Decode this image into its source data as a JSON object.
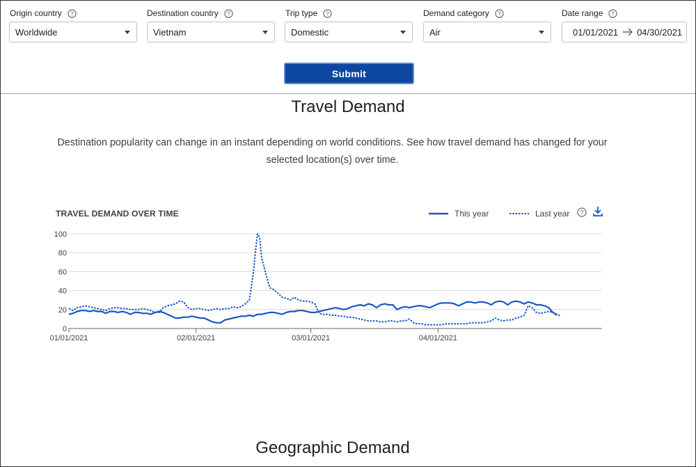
{
  "filters": {
    "origin": {
      "label": "Origin country",
      "value": "Worldwide"
    },
    "destination": {
      "label": "Destination country",
      "value": "Vietnam"
    },
    "trip_type": {
      "label": "Trip type",
      "value": "Domestic"
    },
    "demand_category": {
      "label": "Demand category",
      "value": "Air"
    },
    "date_range": {
      "label": "Date range",
      "start": "01/01/2021",
      "end": "04/30/2021"
    }
  },
  "submit_label": "Submit",
  "page_title": "Travel Demand",
  "description": "Destination popularity can change in an instant depending on world conditions. See how travel demand has changed for your selected location(s) over time.",
  "chart_title": "TRAVEL DEMAND OVER TIME",
  "legend": {
    "this_year": "This year",
    "last_year": "Last year"
  },
  "section_title": "Geographic Demand",
  "colors": {
    "accent": "#1a56c4",
    "submit": "#0d47a1"
  },
  "chart_data": {
    "type": "line",
    "title": "TRAVEL DEMAND OVER TIME",
    "x_ticks": [
      "01/01/2021",
      "02/01/2021",
      "03/01/2021",
      "04/01/2021"
    ],
    "x_tick_days": [
      0,
      31,
      59,
      90
    ],
    "y_ticks": [
      0,
      20,
      40,
      60,
      80,
      100
    ],
    "ylim": [
      0,
      100
    ],
    "x_range_days": [
      0,
      130
    ],
    "grid": true,
    "legend_position": "top-right",
    "series": [
      {
        "name": "This year",
        "style": "solid",
        "points": [
          [
            0,
            15
          ],
          [
            1,
            16
          ],
          [
            2,
            18
          ],
          [
            3,
            19
          ],
          [
            4,
            19
          ],
          [
            5,
            18
          ],
          [
            6,
            19
          ],
          [
            7,
            18
          ],
          [
            8,
            18
          ],
          [
            9,
            16
          ],
          [
            10,
            18
          ],
          [
            11,
            18
          ],
          [
            12,
            17
          ],
          [
            13,
            18
          ],
          [
            14,
            17
          ],
          [
            15,
            15
          ],
          [
            16,
            17
          ],
          [
            17,
            17
          ],
          [
            18,
            16
          ],
          [
            19,
            16
          ],
          [
            20,
            15
          ],
          [
            21,
            17
          ],
          [
            22,
            18
          ],
          [
            23,
            17
          ],
          [
            24,
            15
          ],
          [
            25,
            13
          ],
          [
            26,
            11
          ],
          [
            27,
            11
          ],
          [
            28,
            12
          ],
          [
            29,
            12
          ],
          [
            30,
            13
          ],
          [
            31,
            12
          ],
          [
            32,
            11
          ],
          [
            33,
            11
          ],
          [
            34,
            9
          ],
          [
            35,
            7
          ],
          [
            36,
            6
          ],
          [
            37,
            6
          ],
          [
            38,
            9
          ],
          [
            39,
            10
          ],
          [
            40,
            11
          ],
          [
            41,
            12
          ],
          [
            42,
            13
          ],
          [
            43,
            13
          ],
          [
            44,
            14
          ],
          [
            45,
            13
          ],
          [
            46,
            15
          ],
          [
            47,
            15
          ],
          [
            48,
            16
          ],
          [
            49,
            17
          ],
          [
            50,
            17
          ],
          [
            51,
            16
          ],
          [
            52,
            15
          ],
          [
            53,
            17
          ],
          [
            54,
            18
          ],
          [
            55,
            18
          ],
          [
            56,
            19
          ],
          [
            57,
            19
          ],
          [
            58,
            18
          ],
          [
            59,
            17
          ],
          [
            60,
            17
          ],
          [
            61,
            18
          ],
          [
            62,
            19
          ],
          [
            63,
            20
          ],
          [
            64,
            21
          ],
          [
            65,
            22
          ],
          [
            66,
            21
          ],
          [
            67,
            20
          ],
          [
            68,
            21
          ],
          [
            69,
            23
          ],
          [
            70,
            24
          ],
          [
            71,
            25
          ],
          [
            72,
            24
          ],
          [
            73,
            26
          ],
          [
            74,
            25
          ],
          [
            75,
            22
          ],
          [
            76,
            25
          ],
          [
            77,
            26
          ],
          [
            78,
            25
          ],
          [
            79,
            25
          ],
          [
            80,
            20
          ],
          [
            81,
            22
          ],
          [
            82,
            23
          ],
          [
            83,
            22
          ],
          [
            84,
            23
          ],
          [
            85,
            24
          ],
          [
            86,
            24
          ],
          [
            87,
            23
          ],
          [
            88,
            22
          ],
          [
            89,
            24
          ],
          [
            90,
            26
          ],
          [
            91,
            27
          ],
          [
            92,
            27
          ],
          [
            93,
            27
          ],
          [
            94,
            26
          ],
          [
            95,
            24
          ],
          [
            96,
            26
          ],
          [
            97,
            28
          ],
          [
            98,
            28
          ],
          [
            99,
            27
          ],
          [
            100,
            28
          ],
          [
            101,
            28
          ],
          [
            102,
            27
          ],
          [
            103,
            25
          ],
          [
            104,
            28
          ],
          [
            105,
            29
          ],
          [
            106,
            28
          ],
          [
            107,
            25
          ],
          [
            108,
            28
          ],
          [
            109,
            29
          ],
          [
            110,
            28
          ],
          [
            111,
            26
          ],
          [
            112,
            28
          ],
          [
            113,
            27
          ],
          [
            114,
            25
          ],
          [
            115,
            25
          ],
          [
            116,
            24
          ],
          [
            117,
            22
          ],
          [
            118,
            17
          ],
          [
            119,
            14
          ]
        ]
      },
      {
        "name": "Last year",
        "style": "dotted",
        "points": [
          [
            0,
            21
          ],
          [
            1,
            19
          ],
          [
            2,
            22
          ],
          [
            3,
            23
          ],
          [
            4,
            24
          ],
          [
            5,
            23
          ],
          [
            6,
            22
          ],
          [
            7,
            21
          ],
          [
            8,
            20
          ],
          [
            9,
            19
          ],
          [
            10,
            21
          ],
          [
            11,
            22
          ],
          [
            12,
            22
          ],
          [
            13,
            21
          ],
          [
            14,
            21
          ],
          [
            15,
            20
          ],
          [
            16,
            20
          ],
          [
            17,
            20
          ],
          [
            18,
            21
          ],
          [
            19,
            20
          ],
          [
            20,
            19
          ],
          [
            21,
            17
          ],
          [
            22,
            17
          ],
          [
            23,
            22
          ],
          [
            24,
            24
          ],
          [
            25,
            25
          ],
          [
            26,
            26
          ],
          [
            27,
            29
          ],
          [
            28,
            28
          ],
          [
            29,
            22
          ],
          [
            30,
            20
          ],
          [
            31,
            21
          ],
          [
            32,
            21
          ],
          [
            33,
            20
          ],
          [
            34,
            19
          ],
          [
            35,
            20
          ],
          [
            36,
            21
          ],
          [
            37,
            20
          ],
          [
            38,
            21
          ],
          [
            39,
            21
          ],
          [
            40,
            23
          ],
          [
            41,
            22
          ],
          [
            42,
            23
          ],
          [
            43,
            26
          ],
          [
            44,
            30
          ],
          [
            45,
            60
          ],
          [
            45.5,
            82
          ],
          [
            46,
            100
          ],
          [
            46.5,
            96
          ],
          [
            47,
            75
          ],
          [
            48,
            58
          ],
          [
            49,
            43
          ],
          [
            50,
            41
          ],
          [
            51,
            37
          ],
          [
            52,
            33
          ],
          [
            53,
            32
          ],
          [
            54,
            30
          ],
          [
            55,
            33
          ],
          [
            56,
            30
          ],
          [
            57,
            29
          ],
          [
            58,
            29
          ],
          [
            59,
            28
          ],
          [
            60,
            26
          ],
          [
            61,
            16
          ],
          [
            62,
            15
          ],
          [
            63,
            15
          ],
          [
            64,
            14
          ],
          [
            65,
            14
          ],
          [
            66,
            13
          ],
          [
            67,
            13
          ],
          [
            68,
            12
          ],
          [
            69,
            12
          ],
          [
            70,
            11
          ],
          [
            71,
            10
          ],
          [
            72,
            9
          ],
          [
            73,
            8
          ],
          [
            74,
            8
          ],
          [
            75,
            8
          ],
          [
            76,
            7
          ],
          [
            77,
            7
          ],
          [
            78,
            8
          ],
          [
            79,
            8
          ],
          [
            80,
            7
          ],
          [
            81,
            8
          ],
          [
            82,
            8
          ],
          [
            83,
            10
          ],
          [
            84,
            6
          ],
          [
            85,
            5
          ],
          [
            86,
            5
          ],
          [
            87,
            4
          ],
          [
            88,
            4
          ],
          [
            89,
            4
          ],
          [
            90,
            4
          ],
          [
            91,
            4
          ],
          [
            92,
            5
          ],
          [
            93,
            5
          ],
          [
            94,
            5
          ],
          [
            95,
            5
          ],
          [
            96,
            5
          ],
          [
            97,
            5
          ],
          [
            98,
            6
          ],
          [
            99,
            6
          ],
          [
            100,
            6
          ],
          [
            101,
            6
          ],
          [
            102,
            7
          ],
          [
            103,
            8
          ],
          [
            104,
            11
          ],
          [
            105,
            9
          ],
          [
            106,
            8
          ],
          [
            107,
            9
          ],
          [
            108,
            9
          ],
          [
            109,
            11
          ],
          [
            110,
            12
          ],
          [
            111,
            14
          ],
          [
            112,
            24
          ],
          [
            113,
            22
          ],
          [
            114,
            17
          ],
          [
            115,
            16
          ],
          [
            116,
            17
          ],
          [
            117,
            18
          ],
          [
            118,
            17
          ],
          [
            119,
            15
          ],
          [
            120,
            13
          ]
        ]
      }
    ]
  }
}
